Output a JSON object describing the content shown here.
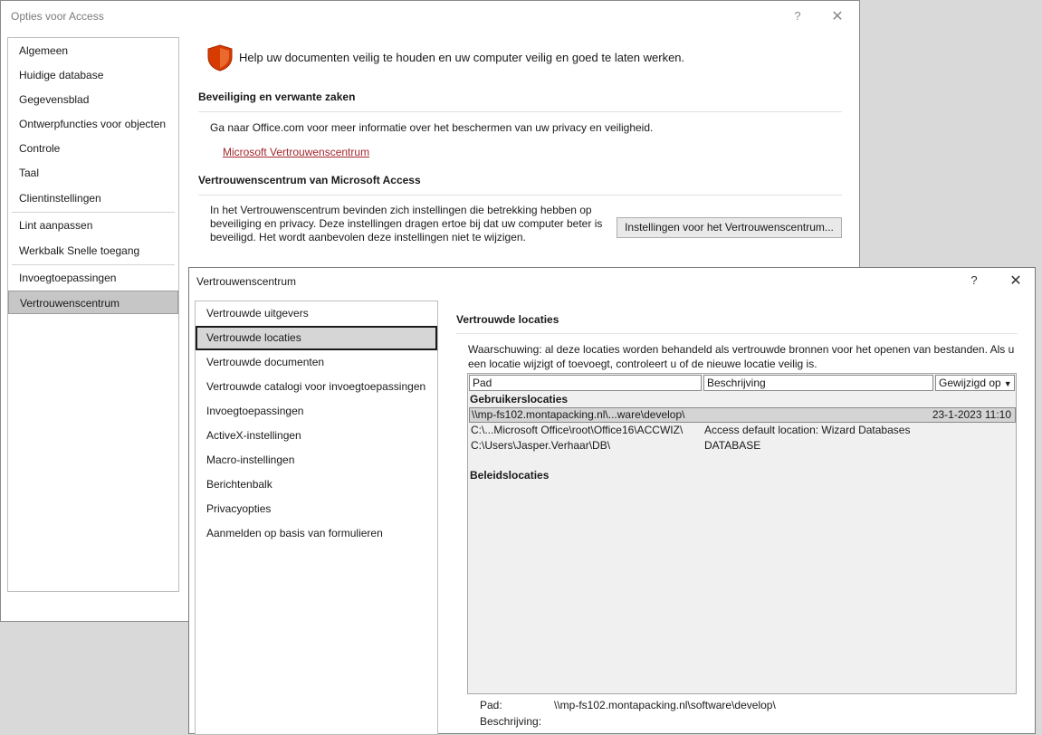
{
  "options_window": {
    "title": "Opties voor Access",
    "help_glyph": "?",
    "close_glyph": "✕",
    "nav": [
      {
        "label": "Algemeen"
      },
      {
        "label": "Huidige database"
      },
      {
        "label": "Gegevensblad"
      },
      {
        "label": "Ontwerpfuncties voor objecten"
      },
      {
        "label": "Controle"
      },
      {
        "label": "Taal"
      },
      {
        "label": "Clientinstellingen"
      },
      {
        "label": "Lint aanpassen"
      },
      {
        "label": "Werkbalk Snelle toegang"
      },
      {
        "label": "Invoegtoepassingen"
      },
      {
        "label": "Vertrouwenscentrum"
      }
    ],
    "selected_nav": "Vertrouwenscentrum",
    "help_text": "Help uw documenten veilig te houden en uw computer veilig en goed te laten werken.",
    "section1_heading": "Beveiliging en verwante zaken",
    "office_text": "Ga naar Office.com voor meer informatie over het beschermen van uw privacy en veiligheid.",
    "ms_link": "Microsoft Vertrouwenscentrum",
    "section2_heading": "Vertrouwenscentrum van Microsoft Access",
    "trust_desc": "In het Vertrouwenscentrum bevinden zich instellingen die betrekking hebben op beveiliging en privacy. Deze instellingen dragen ertoe bij dat uw computer beter is beveiligd. Het wordt aanbevolen deze instellingen niet te wijzigen.",
    "trust_button": "Instellingen voor het Vertrouwenscentrum...",
    "shield_color": "#d83b01"
  },
  "trust_center": {
    "title": "Vertrouwenscentrum",
    "help_glyph": "?",
    "close_glyph": "✕",
    "nav": [
      {
        "label": "Vertrouwde uitgevers"
      },
      {
        "label": "Vertrouwde locaties"
      },
      {
        "label": "Vertrouwde documenten"
      },
      {
        "label": "Vertrouwde catalogi voor invoegtoepassingen"
      },
      {
        "label": "Invoegtoepassingen"
      },
      {
        "label": "ActiveX-instellingen"
      },
      {
        "label": "Macro-instellingen"
      },
      {
        "label": "Berichtenbalk"
      },
      {
        "label": "Privacyopties"
      },
      {
        "label": "Aanmelden op basis van formulieren"
      }
    ],
    "selected_nav": "Vertrouwde locaties",
    "section_heading": "Vertrouwde locaties",
    "warning": "Waarschuwing: al deze locaties worden behandeld als vertrouwde bronnen voor het openen van bestanden. Als u een locatie wijzigt of toevoegt, controleert u of de nieuwe locatie veilig is.",
    "table": {
      "headers": {
        "path": "Pad",
        "description": "Beschrijving",
        "modified": "Gewijzigd op"
      },
      "sort_glyph": "▼",
      "user_group": "Gebruikerslocaties",
      "rows": [
        {
          "path": "\\\\mp-fs102.montapacking.nl\\...ware\\develop\\",
          "description": "",
          "modified": "23-1-2023 11:10"
        },
        {
          "path": "C:\\...Microsoft Office\\root\\Office16\\ACCWIZ\\",
          "description": "Access default location: Wizard Databases",
          "modified": ""
        },
        {
          "path": "C:\\Users\\Jasper.Verhaar\\DB\\",
          "description": "DATABASE",
          "modified": ""
        }
      ],
      "policy_group": "Beleidslocaties"
    },
    "detail": {
      "path_label": "Pad:",
      "path_value": "\\\\mp-fs102.montapacking.nl\\software\\develop\\",
      "description_label": "Beschrijving:"
    }
  }
}
